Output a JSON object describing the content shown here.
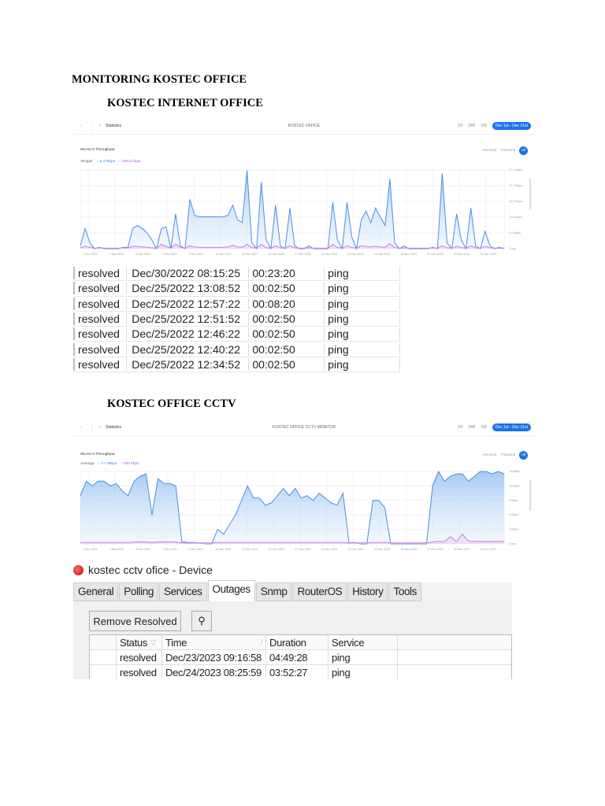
{
  "heading": "MONITORING KOSTEC OFFICE",
  "sections": [
    {
      "title": "KOSTEC INTERNET OFFICE"
    },
    {
      "title": "KOSTEC OFFICE CCTV"
    }
  ],
  "shot1": {
    "nav_label": "Statistics",
    "device_title": "KOSTEC OFFICE",
    "ranges": [
      "1H",
      "24H",
      "1W"
    ],
    "active_range": "Dec 1st - Dec 31st",
    "card_title": "WLAN 0 Throughput",
    "filters": [
      "Receive",
      "Transmit"
    ],
    "filter_active": "All",
    "legend_label": "Tengah",
    "download": "↓ 5.3 Mbps",
    "upload": "↑ 330.5 kbps"
  },
  "shot2": {
    "nav_label": "Statistics",
    "device_title": "KOSTEC OFFICE CCTV MONITOR",
    "ranges": [
      "1H",
      "24H",
      "1W"
    ],
    "active_range": "Dec 1st - Dec 31st",
    "card_title": "WLAN 0 Throughput",
    "filters": [
      "Receive",
      "Transmit"
    ],
    "filter_active": "All",
    "legend_label": "Average",
    "download": "↓ 7.7 Mbps",
    "upload": "↑ 400 kbps"
  },
  "chart_data": [
    {
      "type": "area",
      "title": "WLAN 0 Throughput",
      "ylabel": "Mbps",
      "ylim": [
        0,
        27.1
      ],
      "yticks": [
        "0 bps",
        "5.4 Mbps",
        "10.8 Mbps",
        "16.2 Mbps",
        "21.7 Mbps",
        "27.1 Mbps"
      ],
      "xticks": [
        "1 Dec 2023",
        "3 Dec 2023",
        "5 Dec 2023",
        "7 Dec 2023",
        "9 Dec 2023",
        "11 Dec 2023",
        "13 Dec 2023",
        "15 Dec 2023",
        "17 Dec 2023",
        "19 Dec 2023",
        "21 Dec 2023",
        "23 Dec 2023",
        "25 Dec 2023",
        "27 Dec 2023",
        "29 Dec 2023",
        "31 Dec 2023"
      ],
      "series": [
        {
          "name": "Receive",
          "color": "#4a90e2",
          "values": [
            1,
            7,
            2,
            0,
            0.5,
            0,
            0,
            0,
            0,
            0.5,
            0.5,
            7,
            8,
            7,
            5.5,
            3,
            0,
            7,
            7.5,
            0,
            12,
            1,
            0,
            17,
            11.5,
            11,
            11,
            11,
            11,
            11,
            11,
            11.5,
            15,
            10,
            9,
            27,
            2,
            0,
            23,
            3,
            0,
            15,
            1,
            0,
            14,
            1,
            0,
            0,
            1,
            0,
            0,
            0,
            0,
            16,
            3,
            0,
            16,
            4,
            0,
            10,
            13,
            9,
            14,
            11,
            8,
            24,
            2,
            0,
            1,
            0,
            0,
            0,
            0,
            0,
            0.5,
            0,
            26,
            2,
            0,
            12,
            3,
            0,
            14,
            1,
            0,
            6,
            1,
            0,
            0.5,
            0
          ]
        },
        {
          "name": "Transmit",
          "color": "#c77ddb",
          "values": [
            0.3,
            0.8,
            0.5,
            0.2,
            0.3,
            0.2,
            0.2,
            0.2,
            0.2,
            0.3,
            0.3,
            0.8,
            0.8,
            0.6,
            0.5,
            0.3,
            0.2,
            1.5,
            0.8,
            0.2,
            1.5,
            0.5,
            0.2,
            1,
            0.6,
            0.5,
            0.5,
            0.5,
            0.5,
            0.5,
            0.5,
            0.6,
            1.2,
            0.6,
            0.5,
            1.5,
            0.4,
            0.2,
            1.5,
            0.4,
            0.2,
            1,
            0.3,
            0.2,
            1,
            0.3,
            0.2,
            0.2,
            0.3,
            0.2,
            0.2,
            0.2,
            0.2,
            1.5,
            0.4,
            0.2,
            1,
            0.4,
            0.2,
            1,
            0.8,
            0.6,
            0.9,
            0.6,
            0.5,
            1.8,
            0.4,
            0.2,
            0.3,
            0.2,
            0.2,
            0.2,
            0.2,
            0.2,
            0.3,
            0.2,
            1,
            0.3,
            0.2,
            0.8,
            0.4,
            0.2,
            1,
            0.3,
            0.2,
            0.8,
            0.3,
            0.2,
            0.2,
            0.2
          ]
        }
      ]
    },
    {
      "type": "area",
      "title": "WLAN 0 Throughput",
      "ylabel": "Mbps",
      "ylim": [
        0,
        15
      ],
      "yticks": [
        "0 bps",
        "3 Mbps",
        "6 Mbps",
        "9 Mbps",
        "12 Mbps",
        "15 Mbps"
      ],
      "xticks": [
        "1 Dec 2023",
        "3 Dec 2023",
        "5 Dec 2023",
        "7 Dec 2023",
        "9 Dec 2023",
        "11 Dec 2023",
        "13 Dec 2023",
        "15 Dec 2023",
        "17 Dec 2023",
        "19 Dec 2023",
        "21 Dec 2023",
        "23 Dec 2023",
        "25 Dec 2023",
        "27 Dec 2023",
        "29 Dec 2023",
        "31 Dec 2023"
      ],
      "series": [
        {
          "name": "Receive",
          "color": "#4a90e2",
          "values": [
            10,
            13,
            12,
            13,
            13,
            12,
            12.5,
            11,
            10,
            13,
            14,
            14.5,
            6,
            13.5,
            12.5,
            12.5,
            12,
            0.5,
            0.3,
            0.3,
            0.2,
            0,
            0,
            3,
            2,
            4,
            6,
            9,
            12,
            9.5,
            9.5,
            8,
            8.5,
            10,
            11.5,
            10,
            11.5,
            9.5,
            10,
            9,
            10.5,
            9.5,
            8.5,
            8,
            10.5,
            0.2,
            0.3,
            0,
            0,
            9,
            9,
            7.5,
            0,
            0,
            0,
            0,
            0,
            0,
            0,
            12,
            15,
            13,
            14,
            14.5,
            14.5,
            13,
            14,
            15,
            15,
            14.5,
            15,
            14.5
          ]
        },
        {
          "name": "Transmit",
          "color": "#c77ddb",
          "values": [
            0.3,
            0.3,
            0.3,
            0.3,
            0.3,
            0.3,
            0.3,
            0.3,
            0.3,
            0.4,
            0.4,
            0.4,
            0.3,
            0.4,
            0.4,
            0.4,
            0.4,
            0.2,
            0.2,
            0.2,
            0.2,
            0.2,
            0.2,
            0.3,
            0.3,
            0.3,
            0.3,
            0.3,
            0.3,
            0.3,
            0.3,
            0.3,
            0.3,
            0.3,
            0.3,
            0.3,
            0.3,
            0.3,
            0.3,
            0.3,
            0.3,
            0.3,
            0.3,
            0.3,
            0.3,
            0.2,
            0.2,
            0.2,
            0.2,
            0.3,
            0.3,
            0.3,
            0.2,
            0.2,
            0.2,
            0.2,
            0.2,
            0.2,
            0.2,
            0.4,
            0.5,
            0.5,
            1.5,
            0.5,
            2,
            0.6,
            0.5,
            0.5,
            0.5,
            0.5,
            0.5,
            0.5
          ]
        }
      ]
    }
  ],
  "outages_table1": {
    "rows": [
      [
        "resolved",
        "Dec/30/2022 08:15:25",
        "00:23:20",
        "ping"
      ],
      [
        "resolved",
        "Dec/25/2022 13:08:52",
        "00:02:50",
        "ping"
      ],
      [
        "resolved",
        "Dec/25/2022 12:57:22",
        "00:08:20",
        "ping"
      ],
      [
        "resolved",
        "Dec/25/2022 12:51:52",
        "00:02:50",
        "ping"
      ],
      [
        "resolved",
        "Dec/25/2022 12:46:22",
        "00:02:50",
        "ping"
      ],
      [
        "resolved",
        "Dec/25/2022 12:40:22",
        "00:02:50",
        "ping"
      ],
      [
        "resolved",
        "Dec/25/2022 12:34:52",
        "00:02:50",
        "ping"
      ]
    ]
  },
  "device_window": {
    "title": "kostec cctv ofice - Device",
    "tabs": [
      "General",
      "Polling",
      "Services",
      "Outages",
      "Snmp",
      "RouterOS",
      "History",
      "Tools"
    ],
    "active_tab": "Outages",
    "remove_resolved": "Remove Resolved",
    "find_icon": "binoculars-icon",
    "columns": [
      "Status",
      "Time",
      "Duration",
      "Service"
    ],
    "rows": [
      [
        "resolved",
        "Dec/23/2023 09:16:58",
        "04:49:28",
        "ping"
      ],
      [
        "resolved",
        "Dec/24/2023 08:25:59",
        "03:52:27",
        "ping"
      ]
    ]
  }
}
